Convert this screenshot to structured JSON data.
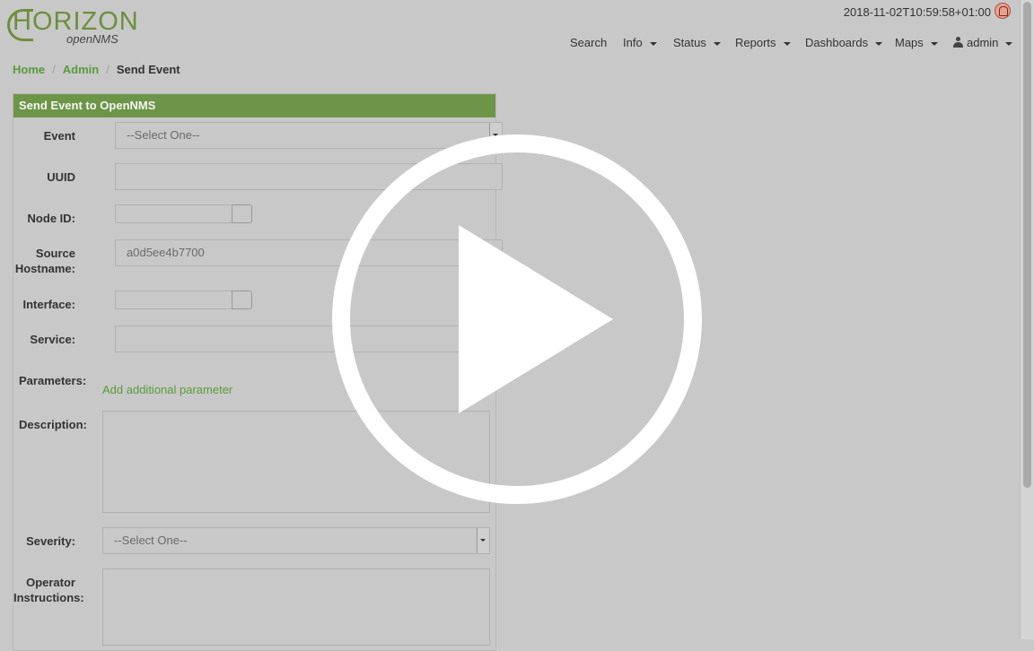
{
  "header": {
    "logo_text": "HORIZON",
    "logo_sub": "openNMS",
    "timestamp": "2018-11-02T10:59:58+01:00",
    "nav": {
      "search": "Search",
      "info": "Info",
      "status": "Status",
      "reports": "Reports",
      "dashboards": "Dashboards",
      "maps": "Maps",
      "user": "admin"
    }
  },
  "breadcrumb": {
    "home": "Home",
    "admin": "Admin",
    "current": "Send Event"
  },
  "form": {
    "title": "Send Event to OpenNMS",
    "labels": {
      "event": "Event",
      "uuid": "UUID",
      "node_id": "Node ID:",
      "source_hostname_1": "Source",
      "source_hostname_2": "Hostname:",
      "interface": "Interface:",
      "service": "Service:",
      "parameters": "Parameters:",
      "description": "Description:",
      "severity": "Severity:",
      "operator_1": "Operator",
      "operator_2": "Instructions:"
    },
    "event_value": "--Select One--",
    "uuid_value": "",
    "source_hostname_value": "a0d5ee4b7700",
    "service_value": "",
    "add_parameter_link": "Add additional parameter",
    "severity_value": "--Select One--"
  },
  "overlay": {
    "icon": "play-icon",
    "color": "#ffffff"
  },
  "colors": {
    "panel_heading": "#6d9548",
    "link": "#5a9a3a",
    "background": "#c8c8c8"
  }
}
